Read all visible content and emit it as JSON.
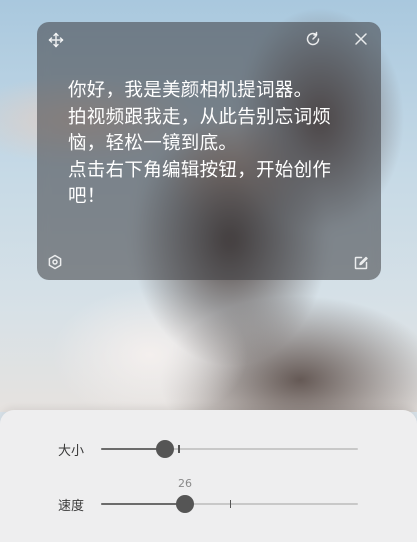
{
  "teleprompter": {
    "text": "你好，我是美颜相机提词器。\n拍视频跟我走，从此告别忘词烦恼，轻松一镜到底。\n点击右下角编辑按钮，开始创作吧！",
    "icons": [
      "move-icon",
      "rotate-icon",
      "close-icon",
      "settings-icon",
      "edit-icon"
    ]
  },
  "controls": {
    "size": {
      "label": "大小",
      "value_fraction": 0.25,
      "default_fraction": 0.3
    },
    "speed": {
      "label": "速度",
      "value": "26",
      "value_fraction": 0.325,
      "default_fraction": 0.5
    }
  },
  "colors": {
    "card_bg": "rgba(60,60,64,0.55)",
    "text": "#ffffff",
    "panel_bg": "#eeeeef",
    "slider_thumb": "#555555"
  }
}
